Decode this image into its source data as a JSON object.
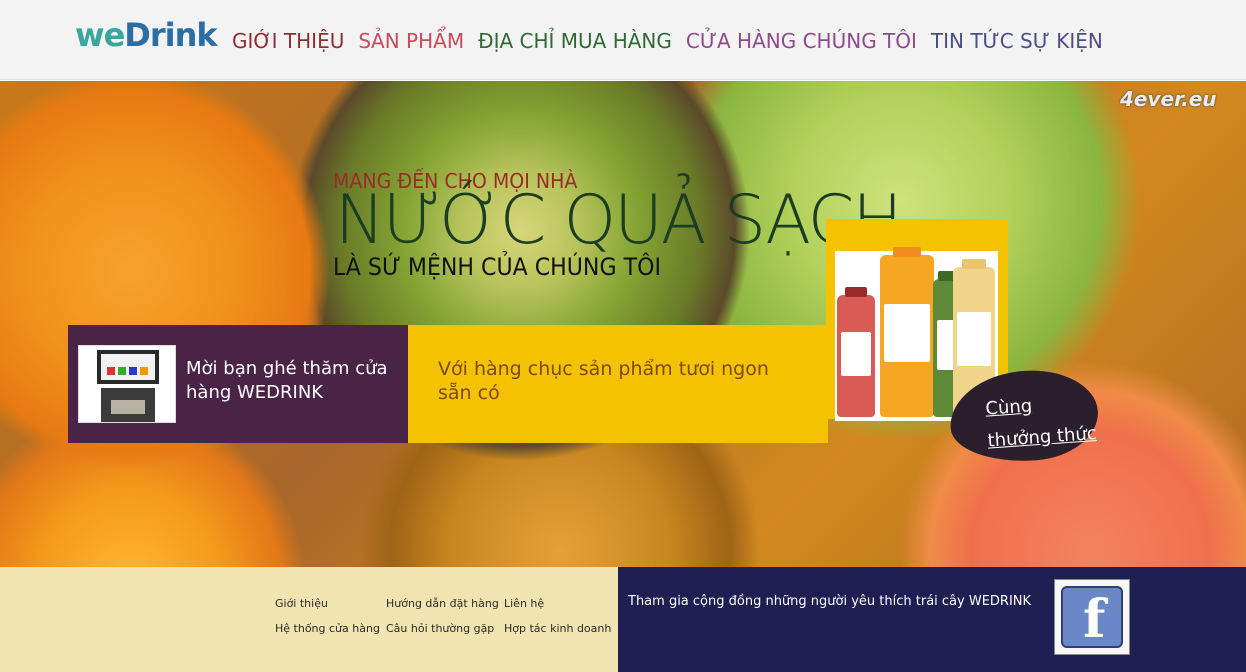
{
  "header": {
    "logo": {
      "we": "we",
      "drink": "Drink"
    },
    "nav": [
      {
        "label": "GIỚI THIỆU",
        "color": "#8c2f35"
      },
      {
        "label": "SẢN PHẨM",
        "color": "#c94a5c"
      },
      {
        "label": "ĐỊA CHỈ MUA HÀNG",
        "color": "#2f6a35"
      },
      {
        "label": "CỬA HÀNG CHÚNG TÔI",
        "color": "#8d4b8c"
      },
      {
        "label": "TIN TỨC SỰ KIỆN",
        "color": "#4a4f8a"
      }
    ]
  },
  "hero": {
    "watermark": "4ever.eu",
    "tagline_small": "MANG ĐẾN CHO MỌI NHÀ",
    "tagline_big": "NƯỚC QUẢ SẠCH",
    "tagline_mid": "LÀ SỨ MỆNH CỦA CHÚNG TÔI",
    "promo_store": "Mời bạn ghé thăm cửa hàng WEDRINK",
    "promo_products": "Với hàng chục sản phẩm tươi ngon sẵn có",
    "cta": "Cùng thưởng thức"
  },
  "footer": {
    "links": [
      {
        "label": "Giới thiệu"
      },
      {
        "label": "Hướng dẫn đặt hàng"
      },
      {
        "label": "Liên hệ"
      },
      {
        "label": "Hệ thống cửa hàng"
      },
      {
        "label": "Câu hỏi thường gặp"
      },
      {
        "label": "Hợp tác kinh doanh"
      }
    ],
    "join_text": "Tham gia cộng đồng những người yêu thích trái cây WEDRINK",
    "facebook": "f"
  },
  "colors": {
    "header_bg": "#f3f3f3",
    "promo_purple": "#4a2447",
    "promo_yellow": "#f5c200",
    "footer_left": "#f0e4b0",
    "footer_right": "#1f1f54"
  }
}
